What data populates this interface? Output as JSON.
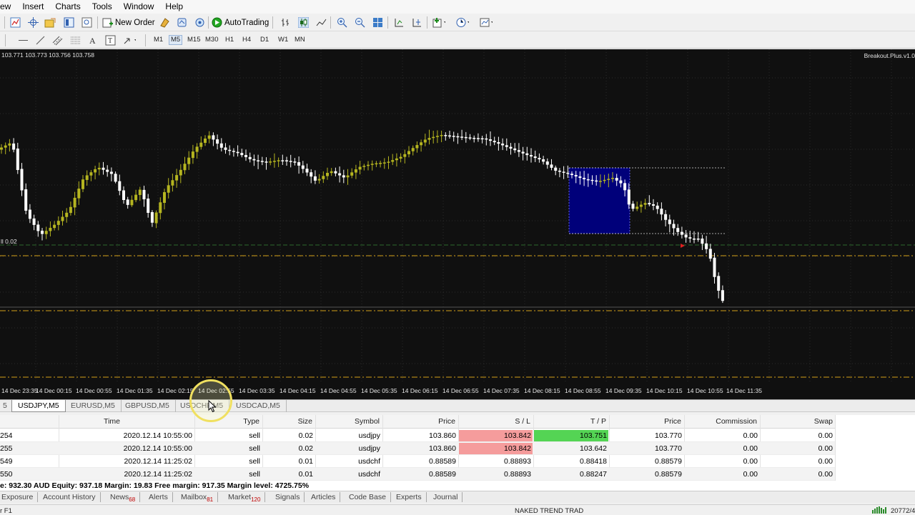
{
  "menu": [
    "ew",
    "Insert",
    "Charts",
    "Tools",
    "Window",
    "Help"
  ],
  "toolbar": {
    "new_order_label": "New Order",
    "autotrading_label": "AutoTrading",
    "timeframes": [
      "M1",
      "M5",
      "M15",
      "M30",
      "H1",
      "H4",
      "D1",
      "W1",
      "MN"
    ],
    "active_timeframe": "M5"
  },
  "chart": {
    "ohlc": "103.771 103.773 103.756 103.758",
    "ea_name": "Breakout.Plus.v1.0",
    "lot_label": "ll 0.02",
    "time_labels": [
      "14 Dec 23:35",
      "14 Dec 00:15",
      "14 Dec 00:55",
      "14 Dec 01:35",
      "14 Dec 02:15",
      "14 Dec 02:55",
      "14 Dec 03:35",
      "14 Dec 04:15",
      "14 Dec 04:55",
      "14 Dec 05:35",
      "14 Dec 06:15",
      "14 Dec 06:55",
      "14 Dec 07:35",
      "14 Dec 08:15",
      "14 Dec 08:55",
      "14 Dec 09:35",
      "14 Dec 10:15",
      "14 Dec 10:55",
      "14 Dec 11:35"
    ],
    "colors": {
      "background": "#101010",
      "bull": "#b5b520",
      "bear": "#ffffff",
      "box": "#00007a",
      "order_line": "#d4a017"
    }
  },
  "chart_tabs": [
    "5",
    "USDJPY,M5",
    "EURUSD,M5",
    "GBPUSD,M5",
    "USDCHF,M5",
    "USDCAD,M5"
  ],
  "active_chart_tab": "USDJPY,M5",
  "trade_table": {
    "headers": [
      "Time",
      "Type",
      "Size",
      "Symbol",
      "Price",
      "S / L",
      "T / P",
      "Price",
      "Commission",
      "Swap"
    ],
    "rows": [
      {
        "order": "254",
        "time": "2020.12.14 10:55:00",
        "type": "sell",
        "size": "0.02",
        "symbol": "usdjpy",
        "price": "103.860",
        "sl": "103.842",
        "tp": "103.751",
        "cur_price": "103.770",
        "commission": "0.00",
        "swap": "0.00"
      },
      {
        "order": "255",
        "time": "2020.12.14 10:55:00",
        "type": "sell",
        "size": "0.02",
        "symbol": "usdjpy",
        "price": "103.860",
        "sl": "103.842",
        "tp": "103.642",
        "cur_price": "103.770",
        "commission": "0.00",
        "swap": "0.00"
      },
      {
        "order": "549",
        "time": "2020.12.14 11:25:02",
        "type": "sell",
        "size": "0.01",
        "symbol": "usdchf",
        "price": "0.88589",
        "sl": "0.88893",
        "tp": "0.88418",
        "cur_price": "0.88579",
        "commission": "0.00",
        "swap": "0.00"
      },
      {
        "order": "550",
        "time": "2020.12.14 11:25:02",
        "type": "sell",
        "size": "0.01",
        "symbol": "usdchf",
        "price": "0.88589",
        "sl": "0.88893",
        "tp": "0.88247",
        "cur_price": "0.88579",
        "commission": "0.00",
        "swap": "0.00"
      }
    ]
  },
  "balance_line": "e: 932.30 AUD  Equity: 937.18  Margin: 19.83  Free margin: 917.35  Margin level: 4725.75%",
  "terminal_tabs": [
    {
      "label": "Exposure",
      "badge": ""
    },
    {
      "label": "Account History",
      "badge": ""
    },
    {
      "label": "News",
      "badge": "68"
    },
    {
      "label": "Alerts",
      "badge": ""
    },
    {
      "label": "Mailbox",
      "badge": "81"
    },
    {
      "label": "Market",
      "badge": "120"
    },
    {
      "label": "Signals",
      "badge": ""
    },
    {
      "label": "Articles",
      "badge": ""
    },
    {
      "label": "Code Base",
      "badge": ""
    },
    {
      "label": "Experts",
      "badge": ""
    },
    {
      "label": "Journal",
      "badge": ""
    }
  ],
  "status": {
    "left": "r F1",
    "middle": "NAKED TREND TRAD",
    "right": "20772/4"
  }
}
